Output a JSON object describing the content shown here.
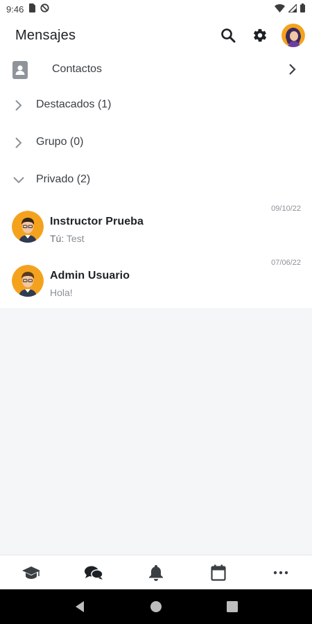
{
  "status_bar": {
    "time": "9:46"
  },
  "header": {
    "title": "Mensajes"
  },
  "contacts": {
    "label": "Contactos"
  },
  "sections": [
    {
      "label": "Destacados (1)",
      "expanded": false
    },
    {
      "label": "Grupo (0)",
      "expanded": false
    },
    {
      "label": "Privado (2)",
      "expanded": true
    }
  ],
  "conversations": [
    {
      "name": "Instructor Prueba",
      "you_prefix": "Tú:",
      "preview": "Test",
      "date": "09/10/22"
    },
    {
      "name": "Admin Usuario",
      "you_prefix": "",
      "preview": "Hola!",
      "date": "07/06/22"
    }
  ],
  "bottom_nav": [
    {
      "icon": "graduation-cap-icon"
    },
    {
      "icon": "chat-bubbles-icon"
    },
    {
      "icon": "bell-icon"
    },
    {
      "icon": "calendar-icon"
    },
    {
      "icon": "more-icon"
    }
  ],
  "colors": {
    "accent": "#f4a21e",
    "text": "#1d2125",
    "muted": "#8a9198",
    "background": "#f5f6f8"
  }
}
